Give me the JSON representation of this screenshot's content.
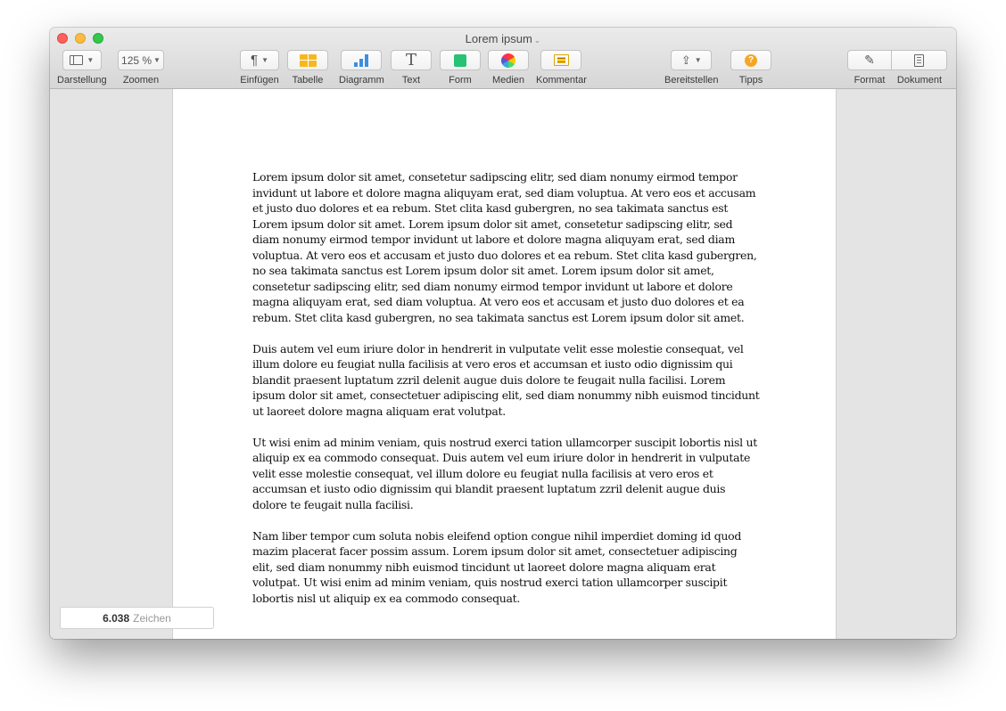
{
  "window": {
    "title": "Lorem ipsum"
  },
  "toolbar": {
    "zoom_value": "125 %",
    "items": {
      "darstellung": "Darstellung",
      "zoomen": "Zoomen",
      "einfuegen": "Einfügen",
      "tabelle": "Tabelle",
      "diagramm": "Diagramm",
      "text": "Text",
      "form": "Form",
      "medien": "Medien",
      "kommentar": "Kommentar",
      "bereitstellen": "Bereitstellen",
      "tipps": "Tipps",
      "format": "Format",
      "dokument": "Dokument"
    },
    "icons": [
      "view-icon",
      "paragraph-icon",
      "table-icon",
      "chart-icon",
      "text-icon",
      "shape-icon",
      "media-icon",
      "comment-icon",
      "share-icon",
      "tips-icon",
      "format-brush-icon",
      "document-icon"
    ]
  },
  "document": {
    "paragraphs": [
      "Lorem ipsum dolor sit amet, consetetur sadipscing elitr, sed diam nonumy eirmod tempor invidunt ut labore et dolore magna aliquyam erat, sed diam voluptua. At vero eos et accusam et justo duo dolores et ea rebum. Stet clita kasd gubergren, no sea takimata sanctus est Lorem ipsum dolor sit amet. Lorem ipsum dolor sit amet, consetetur sadipscing elitr, sed diam nonumy eirmod tempor invidunt ut labore et dolore magna aliquyam erat, sed diam voluptua. At vero eos et accusam et justo duo dolores et ea rebum. Stet clita kasd gubergren, no sea takimata sanctus est Lorem ipsum dolor sit amet. Lorem ipsum dolor sit amet, consetetur sadipscing elitr, sed diam nonumy eirmod tempor invidunt ut labore et dolore magna aliquyam erat, sed diam voluptua. At vero eos et accusam et justo duo dolores et ea rebum. Stet clita kasd gubergren, no sea takimata sanctus est Lorem ipsum dolor sit amet.",
      "Duis autem vel eum iriure dolor in hendrerit in vulputate velit esse molestie consequat, vel illum dolore eu feugiat nulla facilisis at vero eros et accumsan et iusto odio dignissim qui blandit praesent luptatum zzril delenit augue duis dolore te feugait nulla facilisi. Lorem ipsum dolor sit amet, consectetuer adipiscing elit, sed diam nonummy nibh euismod tincidunt ut laoreet dolore magna aliquam erat volutpat.",
      "Ut wisi enim ad minim veniam, quis nostrud exerci tation ullamcorper suscipit lobortis nisl ut aliquip ex ea commodo consequat. Duis autem vel eum iriure dolor in hendrerit in vulputate velit esse molestie consequat, vel illum dolore eu feugiat nulla facilisis at vero eros et accumsan et iusto odio dignissim qui blandit praesent luptatum zzril delenit augue duis dolore te feugait nulla facilisi.",
      "Nam liber tempor cum soluta nobis eleifend option congue nihil imperdiet doming id quod mazim placerat facer possim assum. Lorem ipsum dolor sit amet, consectetuer adipiscing elit, sed diam nonummy nibh euismod tincidunt ut laoreet dolore magna aliquam erat volutpat. Ut wisi enim ad minim veniam, quis nostrud exerci tation ullamcorper suscipit lobortis nisl ut aliquip ex ea commodo consequat."
    ]
  },
  "status": {
    "char_count": "6.038",
    "char_label": "Zeichen"
  }
}
